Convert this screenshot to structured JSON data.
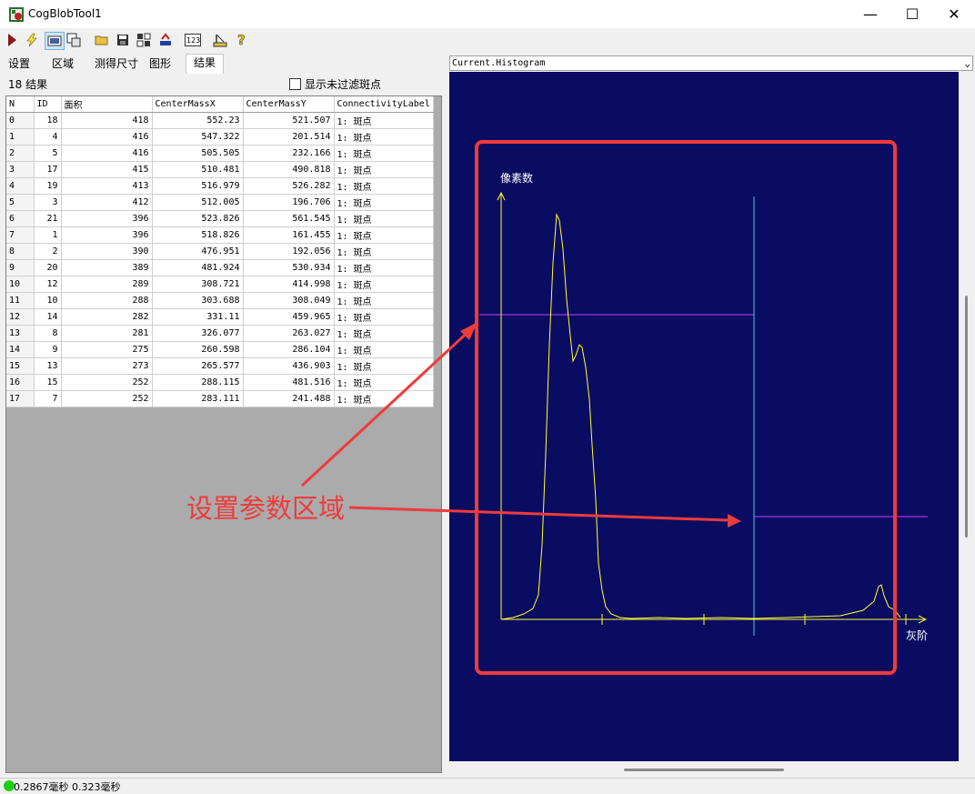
{
  "window": {
    "title": "CogBlobTool1"
  },
  "tabs": [
    "设置",
    "区域",
    "测得尺寸",
    "图形",
    "结果"
  ],
  "results": {
    "count_label": "18 结果",
    "show_unfiltered_label": "显示未过滤斑点",
    "columns": [
      "N",
      "ID",
      "面积",
      "CenterMassX",
      "CenterMassY",
      "ConnectivityLabel"
    ],
    "rows": [
      [
        "0",
        "18",
        "418",
        "552.23",
        "521.507",
        "1: 斑点"
      ],
      [
        "1",
        "4",
        "416",
        "547.322",
        "201.514",
        "1: 斑点"
      ],
      [
        "2",
        "5",
        "416",
        "505.505",
        "232.166",
        "1: 斑点"
      ],
      [
        "3",
        "17",
        "415",
        "510.481",
        "490.818",
        "1: 斑点"
      ],
      [
        "4",
        "19",
        "413",
        "516.979",
        "526.282",
        "1: 斑点"
      ],
      [
        "5",
        "3",
        "412",
        "512.005",
        "196.706",
        "1: 斑点"
      ],
      [
        "6",
        "21",
        "396",
        "523.826",
        "561.545",
        "1: 斑点"
      ],
      [
        "7",
        "1",
        "396",
        "518.826",
        "161.455",
        "1: 斑点"
      ],
      [
        "8",
        "2",
        "390",
        "476.951",
        "192.056",
        "1: 斑点"
      ],
      [
        "9",
        "20",
        "389",
        "481.924",
        "530.934",
        "1: 斑点"
      ],
      [
        "10",
        "12",
        "289",
        "308.721",
        "414.998",
        "1: 斑点"
      ],
      [
        "11",
        "10",
        "288",
        "303.688",
        "308.049",
        "1: 斑点"
      ],
      [
        "12",
        "14",
        "282",
        "331.11",
        "459.965",
        "1: 斑点"
      ],
      [
        "13",
        "8",
        "281",
        "326.077",
        "263.027",
        "1: 斑点"
      ],
      [
        "14",
        "9",
        "275",
        "260.598",
        "286.104",
        "1: 斑点"
      ],
      [
        "15",
        "13",
        "273",
        "265.577",
        "436.903",
        "1: 斑点"
      ],
      [
        "16",
        "15",
        "252",
        "288.115",
        "481.516",
        "1: 斑点"
      ],
      [
        "17",
        "7",
        "252",
        "283.111",
        "241.488",
        "1: 斑点"
      ]
    ]
  },
  "histogram": {
    "selector_value": "Current.Histogram",
    "y_axis_label": "像素数",
    "x_axis_label": "灰阶"
  },
  "annotation": {
    "text": "设置参数区域"
  },
  "status": {
    "text": "0.2867毫秒 0.323毫秒"
  },
  "colors": {
    "histogram_bg": "#0a0c62",
    "curve": "#ffff33",
    "axis": "#ffff33",
    "threshold_line": "#40c8e0",
    "region_line": "#c040ff",
    "annotation": "#ee3b3b"
  }
}
